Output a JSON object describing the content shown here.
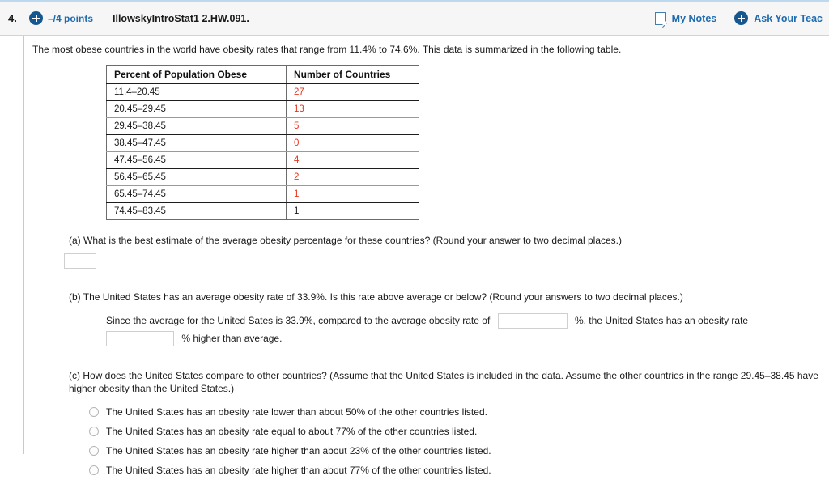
{
  "header": {
    "question_number": "4.",
    "plus_icon": "plus-circle-icon",
    "points": "–/4 points",
    "assignment_title": "IllowskyIntroStat1 2.HW.091.",
    "my_notes_label": "My Notes",
    "my_notes_icon": "note-page-icon",
    "ask_teacher_label": "Ask Your Teac",
    "ask_teacher_icon": "plus-circle-icon",
    "accent_blue": "#1f6bb0",
    "border_blue": "#bcd9f0",
    "bar_background": "#f6f6f6"
  },
  "intro": {
    "text": "The most obese countries in the world have obesity rates that range from 11.4% to 74.6%. This data is summarized in the following table."
  },
  "table": {
    "headers": [
      "Percent of Population Obese",
      "Number of Countries"
    ],
    "answer_color": "#e8341f",
    "rows": [
      {
        "range": "11.4–20.45",
        "count": "27",
        "count_color": "red"
      },
      {
        "range": "20.45–29.45",
        "count": "13",
        "count_color": "red"
      },
      {
        "range": "29.45–38.45",
        "count": "5",
        "count_color": "red"
      },
      {
        "range": "38.45–47.45",
        "count": "0",
        "count_color": "red"
      },
      {
        "range": "47.45–56.45",
        "count": "4",
        "count_color": "red"
      },
      {
        "range": "56.45–65.45",
        "count": "2",
        "count_color": "red"
      },
      {
        "range": "65.45–74.45",
        "count": "1",
        "count_color": "red"
      },
      {
        "range": "74.45–83.45",
        "count": "1",
        "count_color": "dark"
      }
    ]
  },
  "part_a": {
    "question": "(a) What is the best estimate of the average obesity percentage for these countries? (Round your answer to two decimal places.)",
    "answer_value": ""
  },
  "part_b": {
    "question": "(b) The United States has an average obesity rate of 33.9%. Is this rate above average or below? (Round your answers to two decimal places.)",
    "sentence_1": "Since the average for the United Sates is 33.9%, compared to the average obesity rate of",
    "sentence_2": "%, the United States has an obesity rate",
    "sentence_3": "% higher than average.",
    "answer_rate": "",
    "answer_percent": ""
  },
  "part_c": {
    "question": "(c) How does the United States compare to other countries? (Assume that the United States is included in the data. Assume the other countries in the range 29.45–38.45 have higher obesity than the United States.)",
    "options": [
      {
        "label": "The United States has an obesity rate lower than about 50% of the other countries listed.",
        "selected": false
      },
      {
        "label": "The United States has an obesity rate equal to about 77% of the other countries listed.",
        "selected": false
      },
      {
        "label": "The United States has an obesity rate higher than about 23% of the other countries listed.",
        "selected": false
      },
      {
        "label": "The United States has an obesity rate higher than about 77% of the other countries listed.",
        "selected": false
      }
    ]
  }
}
